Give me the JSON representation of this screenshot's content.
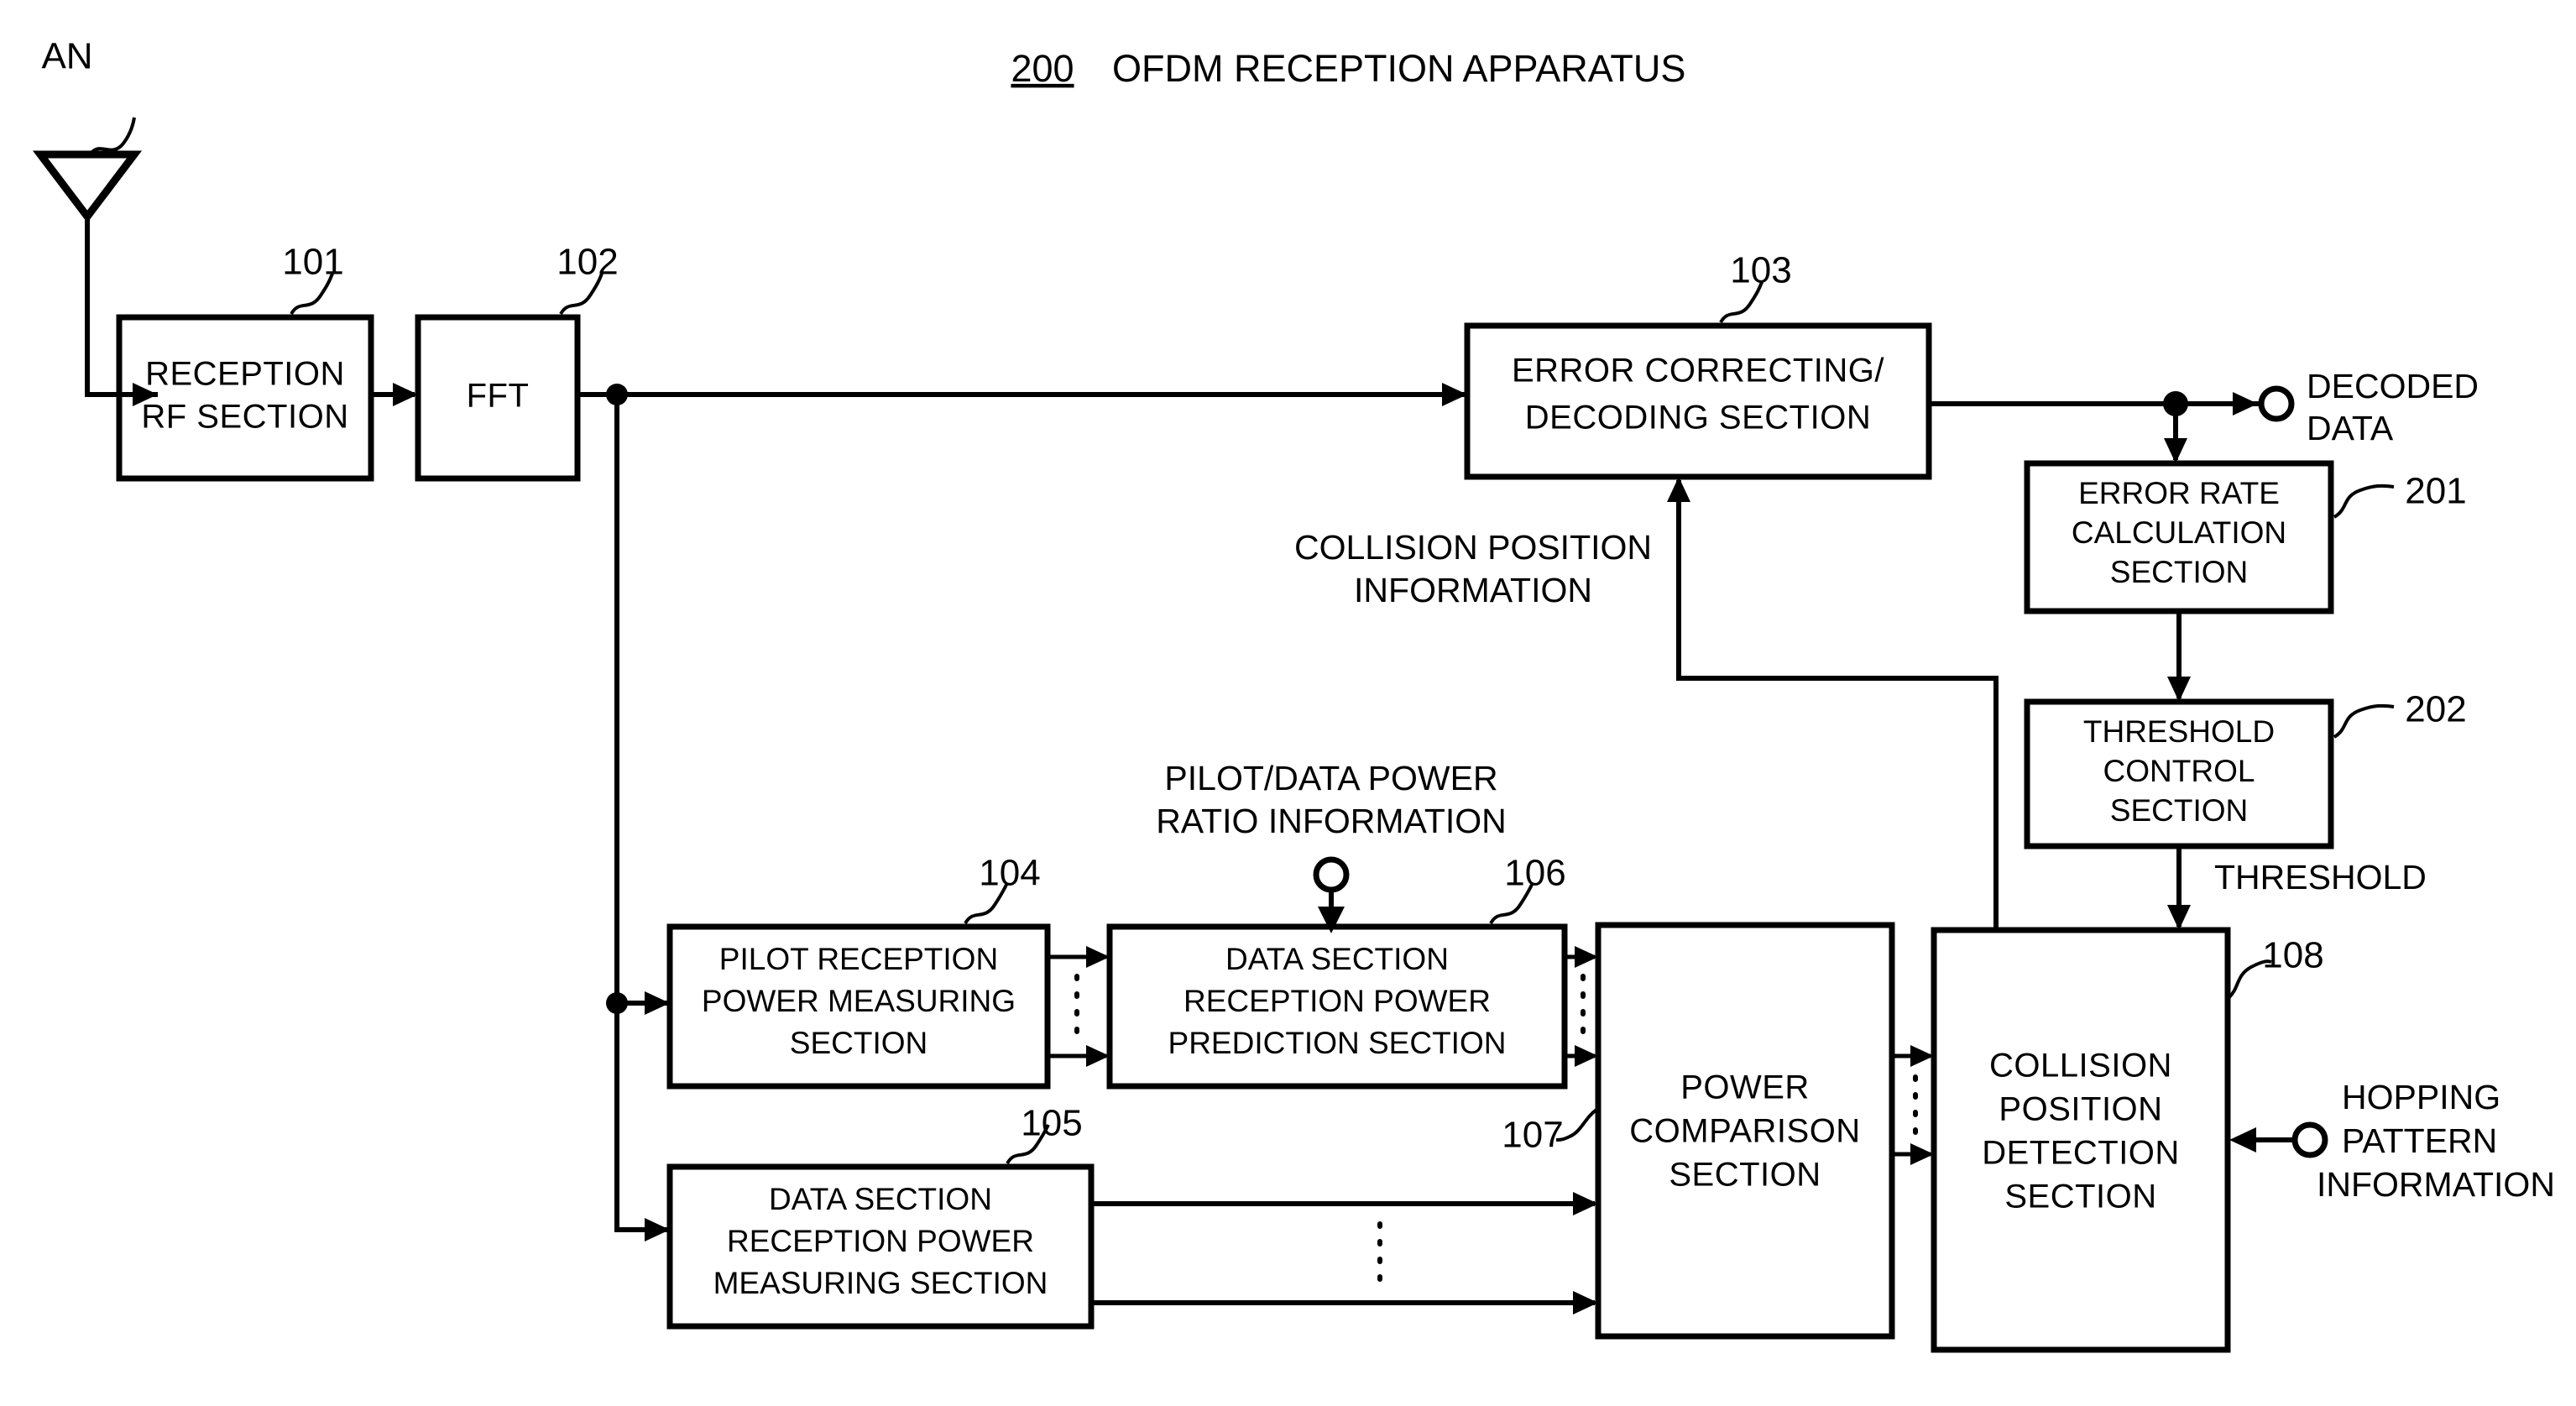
{
  "figure": {
    "title_number": "200",
    "title_text": "OFDM RECEPTION APPARATUS"
  },
  "antenna": {
    "label": "AN"
  },
  "blocks": [
    {
      "ref": "101",
      "lines": [
        "RECEPTION",
        "RF SECTION"
      ]
    },
    {
      "ref": "102",
      "lines": [
        "FFT"
      ]
    },
    {
      "ref": "103",
      "lines": [
        "ERROR CORRECTING/",
        "DECODING SECTION"
      ]
    },
    {
      "ref": "201",
      "lines": [
        "ERROR RATE",
        "CALCULATION",
        "SECTION"
      ]
    },
    {
      "ref": "202",
      "lines": [
        "THRESHOLD",
        "CONTROL",
        "SECTION"
      ]
    },
    {
      "ref": "104",
      "lines": [
        "PILOT RECEPTION",
        "POWER MEASURING",
        "SECTION"
      ]
    },
    {
      "ref": "106",
      "lines": [
        "DATA SECTION",
        "RECEPTION POWER",
        "PREDICTION SECTION"
      ]
    },
    {
      "ref": "105",
      "lines": [
        "DATA SECTION",
        "RECEPTION POWER",
        "MEASURING SECTION"
      ]
    },
    {
      "ref": "107",
      "lines": [
        "POWER",
        "COMPARISON",
        "SECTION"
      ]
    },
    {
      "ref": "108",
      "lines": [
        "COLLISION",
        "POSITION",
        "DETECTION",
        "SECTION"
      ]
    }
  ],
  "signals": {
    "decoded_data": [
      "DECODED",
      "DATA"
    ],
    "collision_position_information": [
      "COLLISION POSITION",
      "INFORMATION"
    ],
    "pilot_data_power_ratio_information": [
      "PILOT/DATA POWER",
      "RATIO INFORMATION"
    ],
    "threshold": "THRESHOLD",
    "hopping_pattern_information": [
      "HOPPING",
      "PATTERN",
      "INFORMATION"
    ]
  },
  "colors": {
    "ink": "#000000",
    "paper": "#ffffff"
  }
}
